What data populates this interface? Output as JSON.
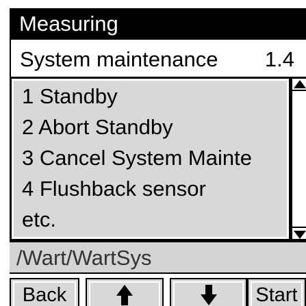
{
  "header": {
    "title": "Measuring"
  },
  "menu": {
    "title": "System maintenance",
    "number": "1.4"
  },
  "list": {
    "items": [
      "1 Standby",
      "2 Abort Standby",
      "3 Cancel System Mainte",
      "4 Flushback sensor",
      "etc."
    ]
  },
  "path": {
    "text": "/Wart/WartSys"
  },
  "buttons": {
    "back": "Back",
    "up_icon": "arrow-up-icon",
    "down_icon": "arrow-down-icon",
    "start": "Start"
  }
}
